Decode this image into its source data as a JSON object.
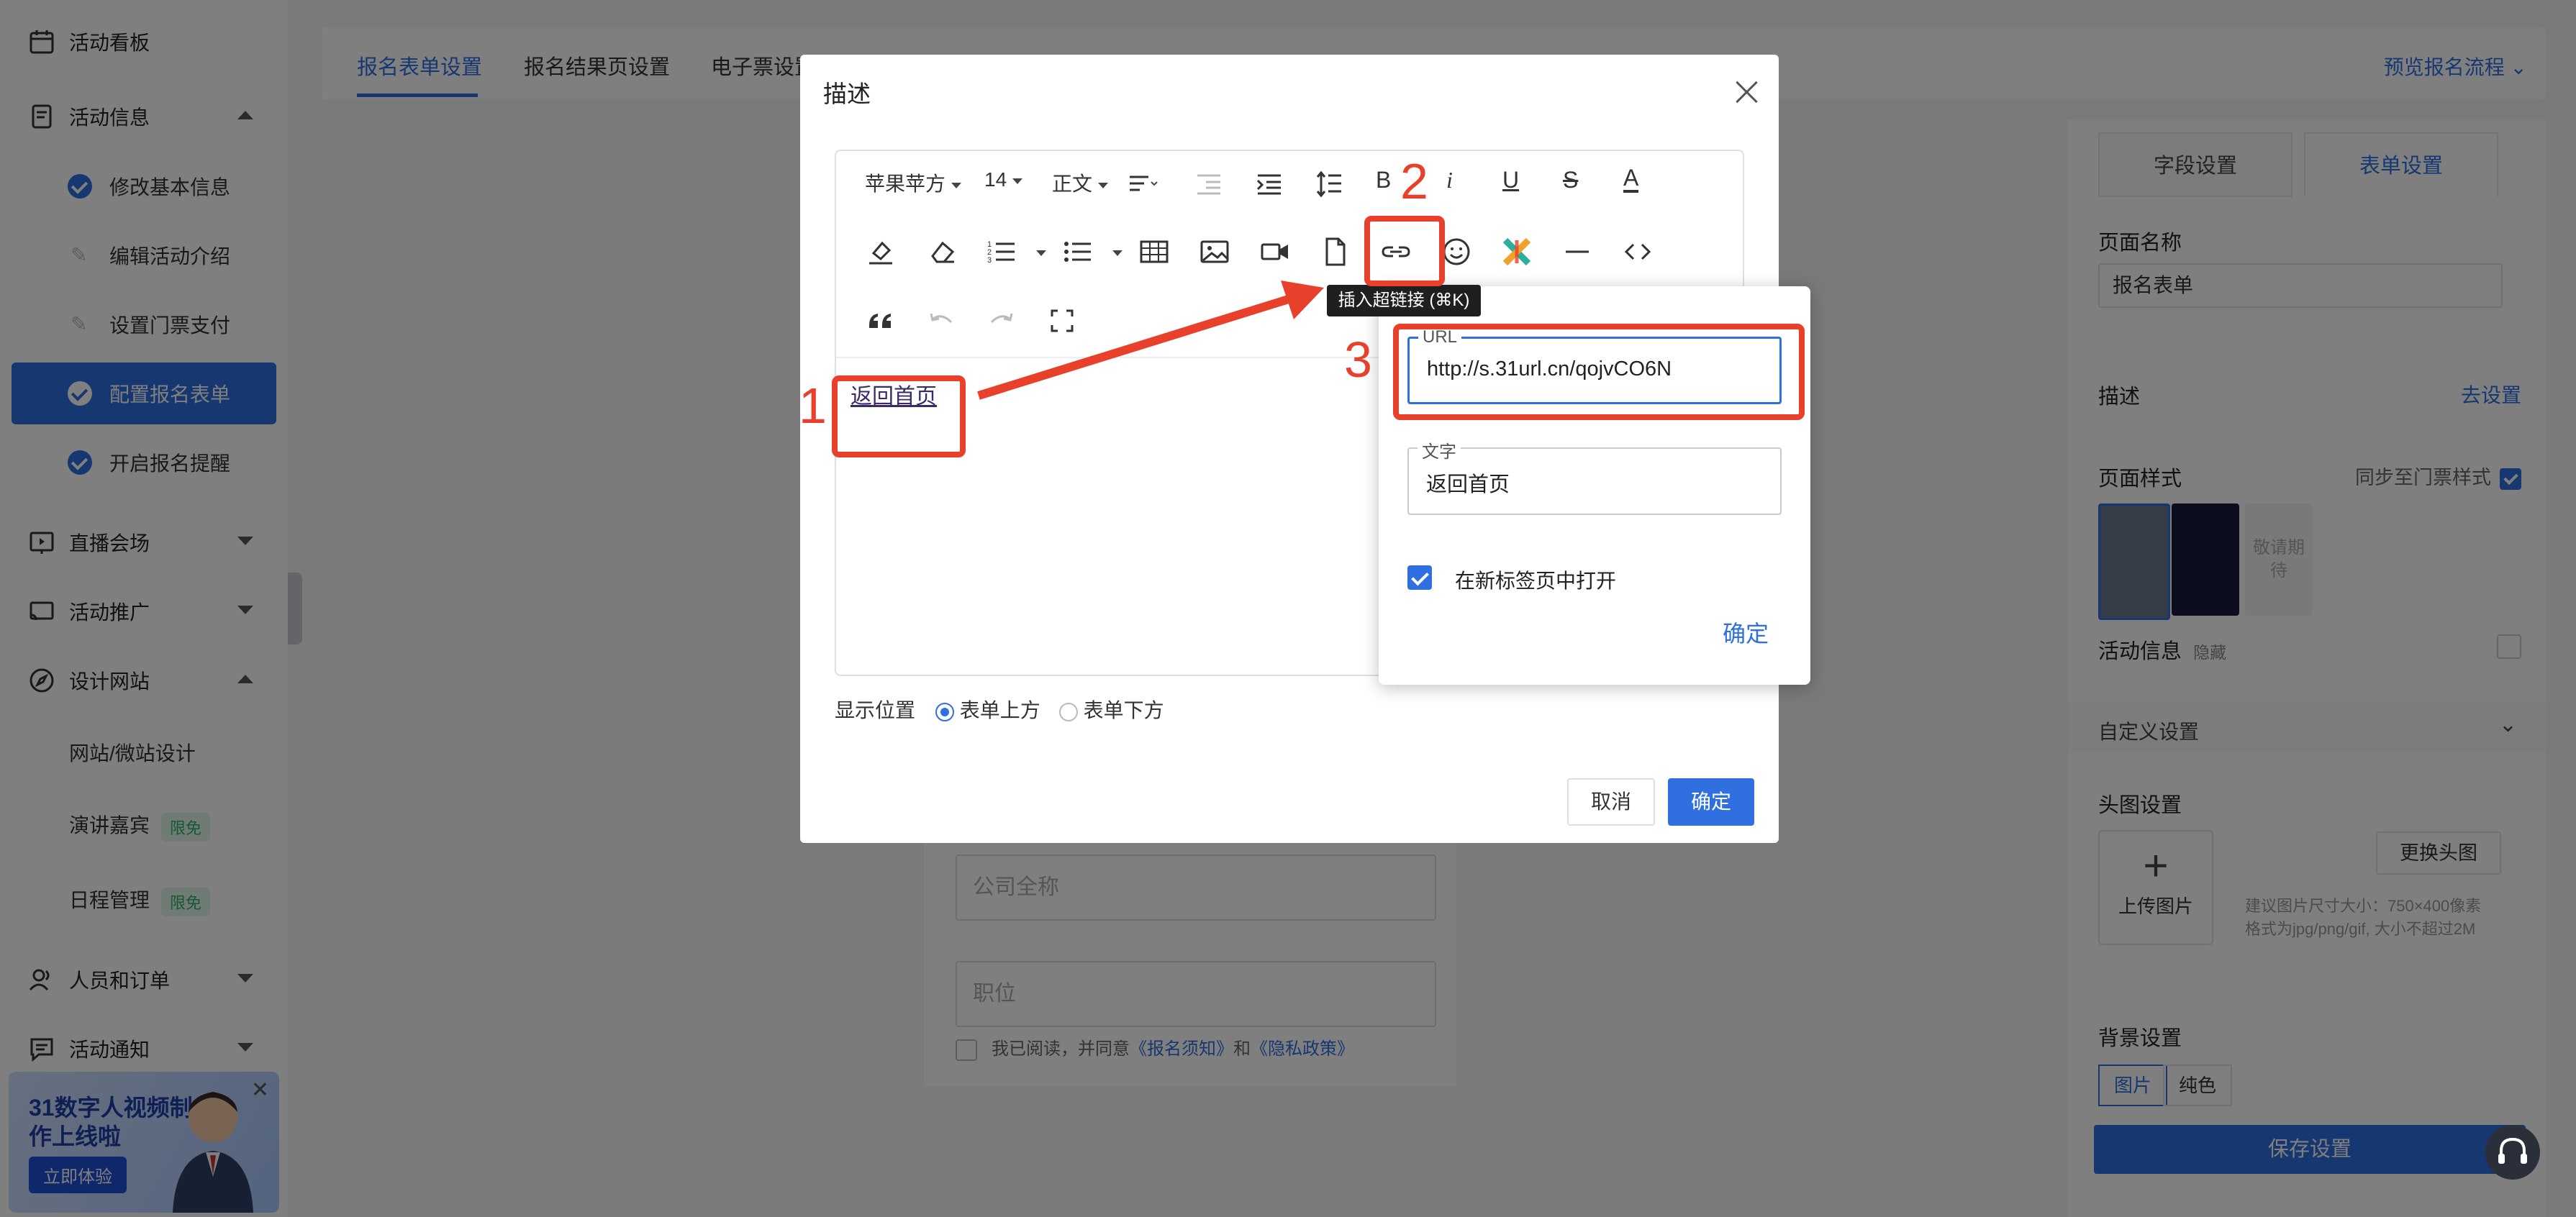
{
  "sidebar": {
    "items": [
      {
        "label": "活动看板",
        "icon": "calendar-icon"
      },
      {
        "label": "活动信息",
        "icon": "document-icon",
        "expanded": true
      },
      {
        "label": "直播会场",
        "icon": "live-icon"
      },
      {
        "label": "活动推广",
        "icon": "cast-icon"
      },
      {
        "label": "设计网站",
        "icon": "compass-icon",
        "expanded": true
      },
      {
        "label": "人员和订单",
        "icon": "people-icon"
      },
      {
        "label": "活动通知",
        "icon": "message-icon"
      }
    ],
    "info_sub": [
      {
        "label": "修改基本信息",
        "state": "done"
      },
      {
        "label": "编辑活动介绍",
        "state": "todo"
      },
      {
        "label": "设置门票支付",
        "state": "todo"
      },
      {
        "label": "配置报名表单",
        "state": "active"
      },
      {
        "label": "开启报名提醒",
        "state": "done"
      }
    ],
    "site_sub": [
      {
        "label": "网站/微站设计",
        "badge": ""
      },
      {
        "label": "演讲嘉宾",
        "badge": "限免"
      },
      {
        "label": "日程管理",
        "badge": "限免"
      }
    ],
    "promo": {
      "title": "31数字人视频制作上线啦",
      "button": "立即体验"
    }
  },
  "topbar": {
    "tabs": [
      "报名表单设置",
      "报名结果页设置",
      "电子票设置"
    ],
    "active_tab": 0,
    "preview": "预览报名流程"
  },
  "form_preview": {
    "company_placeholder": "公司全称",
    "position_placeholder": "职位",
    "agree_prefix": "我已阅读，并同意",
    "agree_link1": "《报名须知》",
    "agree_and": "和",
    "agree_link2": "《隐私政策》"
  },
  "right_panel": {
    "tabs": [
      "字段设置",
      "表单设置"
    ],
    "active_tab": 1,
    "page_name_label": "页面名称",
    "page_name_value": "报名表单",
    "desc_label": "描述",
    "desc_link": "去设置",
    "style_label": "页面样式",
    "sync_label": "同步至门票样式",
    "coming_soon": "敬请期待",
    "activity_info_label": "活动信息",
    "activity_info_hidden": "隐藏",
    "custom_settings": "自定义设置",
    "header_img_label": "头图设置",
    "upload_label": "上传图片",
    "replace_label": "更换头图",
    "hint_line1": "建议图片尺寸大小：750×400像素",
    "hint_line2": "格式为jpg/png/gif, 大小不超过2M",
    "bg_label": "背景设置",
    "bg_options": [
      "图片",
      "纯色"
    ],
    "bg_active": 0,
    "save": "保存设置"
  },
  "dialog": {
    "title": "描述",
    "toolbar": {
      "font_family": "苹果苹方",
      "font_size": "14",
      "paragraph": "正文",
      "bold": "B",
      "italic": "i",
      "underline": "U",
      "strike": "S",
      "font_color": "A"
    },
    "content_link_text": "返回首页",
    "position_label": "显示位置",
    "position_options": [
      "表单上方",
      "表单下方"
    ],
    "position_selected": 0,
    "cancel": "取消",
    "confirm": "确定"
  },
  "tooltip": "插入超链接 (⌘K)",
  "link_popover": {
    "url_label": "URL",
    "url_value": "http://s.31url.cn/qojvCO6N",
    "text_label": "文字",
    "text_value": "返回首页",
    "new_tab_label": "在新标签页中打开",
    "new_tab_checked": true,
    "confirm": "确定"
  },
  "annotations": [
    "1",
    "2",
    "3"
  ],
  "colors": {
    "accent": "#2f6fe0",
    "annotation": "#e8402a",
    "badge_green": "#2cb36b"
  }
}
